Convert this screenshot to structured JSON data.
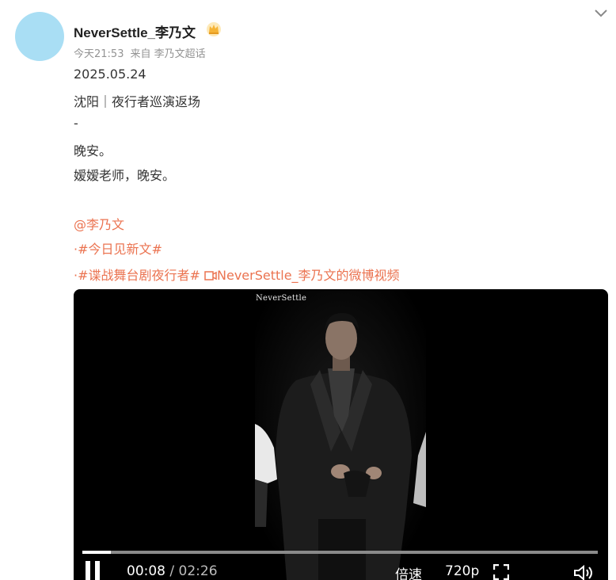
{
  "header": {
    "username": "NeverSettle_李乃文",
    "time": "今天21:53",
    "source": "来自 李乃文超话"
  },
  "post": {
    "lines": [
      "2025.05.24",
      "沈阳｜夜行者巡演返场",
      "-",
      "晚安。",
      "嫒嫒老师，晚安。"
    ],
    "mention": "@李乃文",
    "tag1": "·#今日见新文#",
    "tag2": "·#谍战舞台剧夜行者#",
    "video_link": "NeverSettle_李乃文的微博视频"
  },
  "video": {
    "watermark": "NeverSettle",
    "current_time": "00:08",
    "separator": " / ",
    "duration": "02:26",
    "speed_label": "倍速",
    "quality_label": "720p",
    "progress": 0.055
  },
  "icons": {
    "chevron": "chevron-down-icon",
    "crown": "crown-badge-icon",
    "video_link": "video-camera-icon",
    "pause": "pause-icon",
    "fullscreen": "fullscreen-icon",
    "volume": "volume-icon"
  },
  "colors": {
    "link": "#eb7350",
    "avatar": "#a9def4",
    "crown": "#f5b335"
  }
}
